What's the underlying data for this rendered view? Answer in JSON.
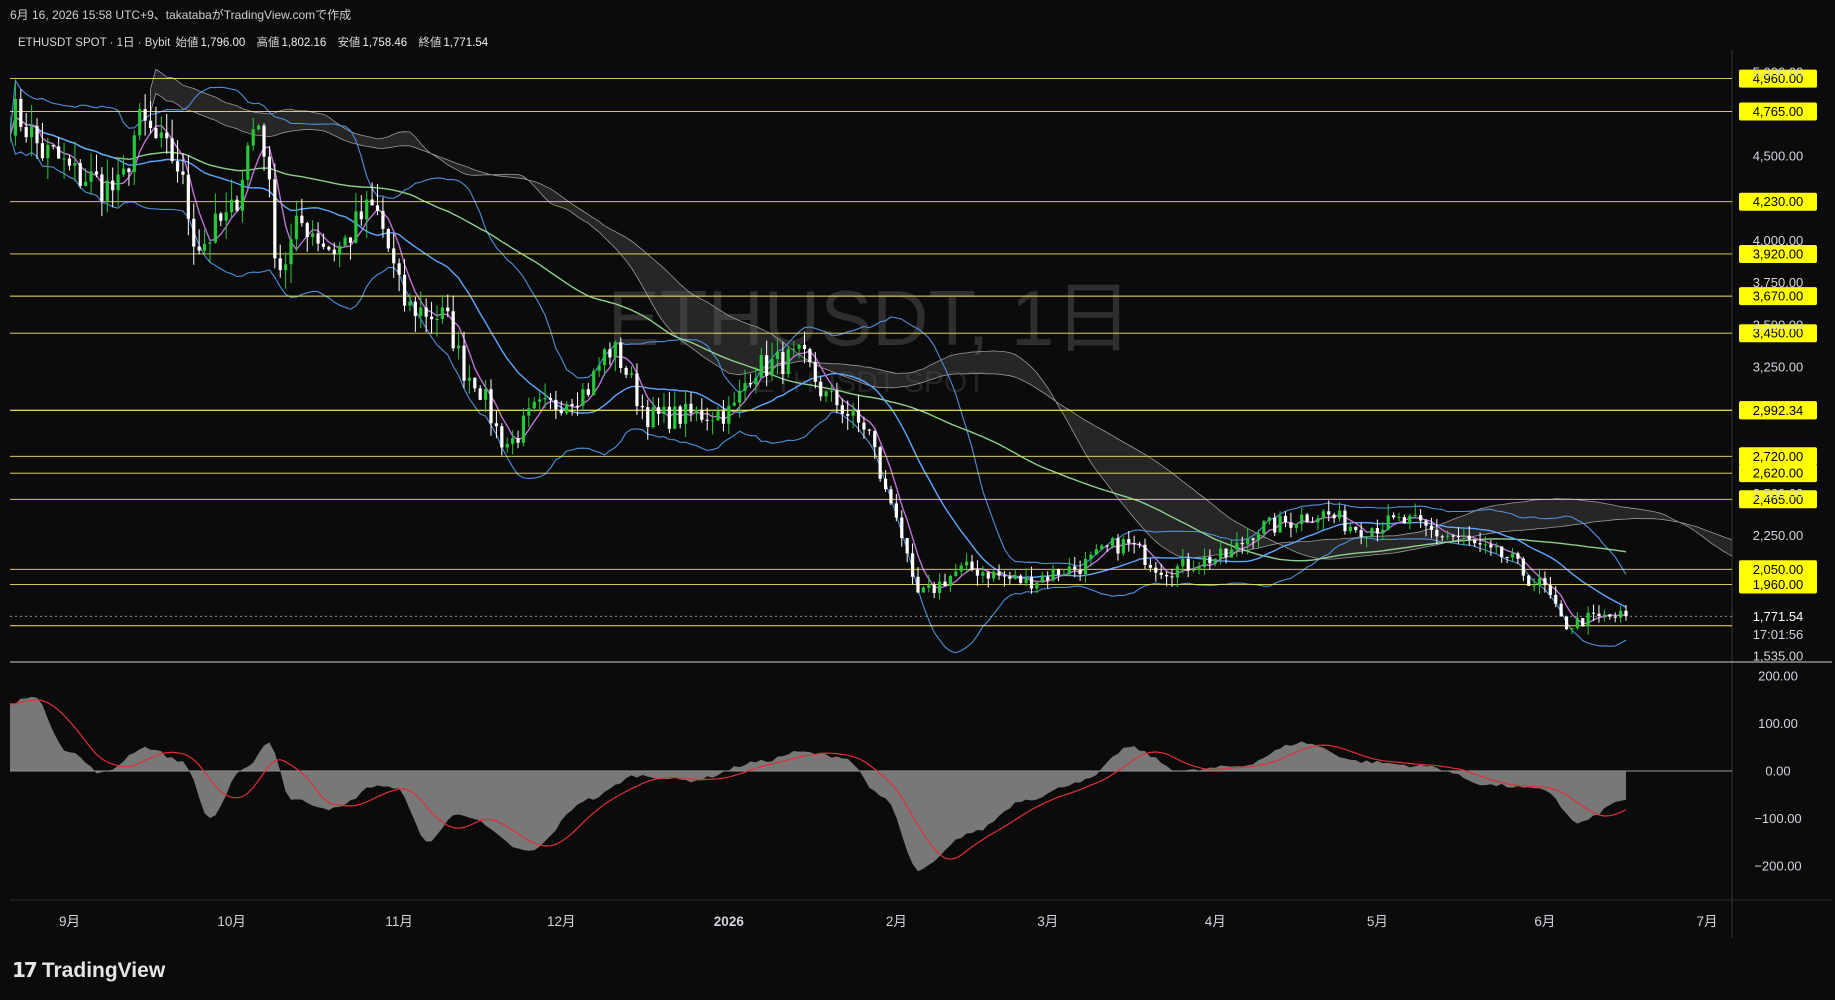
{
  "header": {
    "caption": "6月 16, 2026 15:58 UTC+9、takatabaがTradingView.comで作成",
    "symbol": "ETHUSDT SPOT · 1日 · Bybit",
    "ohlc": [
      {
        "label": "始値",
        "value": "1,796.00"
      },
      {
        "label": "高値",
        "value": "1,802.16"
      },
      {
        "label": "安値",
        "value": "1,758.46"
      },
      {
        "label": "終値",
        "value": "1,771.54"
      }
    ]
  },
  "watermark": {
    "main": "ETHUSDT, 1日",
    "sub": "ETHUSDT SPOT"
  },
  "price_axis": {
    "ticks": [
      "5,000.00",
      "4,500.00",
      "4,000.00",
      "3,750.00",
      "3,500.00",
      "3,250.00",
      "2,500.00",
      "2,250.00",
      "1,535.00"
    ],
    "current_price": "1,771.54",
    "countdown": "17:01:56",
    "horizontal_levels": [
      "4,960.00",
      "4,765.00",
      "4,230.00",
      "3,920.00",
      "3,670.00",
      "3,450.00",
      "2,993.51",
      "2,992.34",
      "2,720.00",
      "2,620.00",
      "2,465.00",
      "2,050.00",
      "1,960.00",
      "1,715.00"
    ]
  },
  "oscillator_axis": {
    "ticks": [
      "200.00",
      "100.00",
      "0.00",
      "−100.00",
      "−200.00"
    ]
  },
  "time_axis": {
    "labels": [
      "9月",
      "10月",
      "11月",
      "12月",
      "2026",
      "2月",
      "3月",
      "4月",
      "5月",
      "6月",
      "7月"
    ]
  },
  "brand": {
    "name": "TradingView"
  },
  "colors": {
    "background": "#0b0b0b",
    "level_line": "#f5e663",
    "level_label_bg": "#ffff00",
    "up_candle": "#26c83a",
    "down_candle": "#ffffff",
    "bollinger": "#4f8fdc",
    "ma_short": "#c070d8",
    "ma_mid": "#5fa6ff",
    "ma_long": "#8ed08e",
    "ichimoku_cloud": "#5a5a5a",
    "oscillator_fill": "#8c8c8c",
    "oscillator_signal": "#e0303a"
  },
  "chart_data": {
    "type": "candlestick",
    "title": "ETHUSDT, 1日",
    "x_range": [
      "2025-08-21",
      "2026-06-16"
    ],
    "price_range": [
      1500,
      5100
    ],
    "candles_anchor_closes": [
      [
        "2025-08-22",
        4740
      ],
      [
        "2025-08-28",
        4510
      ],
      [
        "2025-09-03",
        4380
      ],
      [
        "2025-09-10",
        4300
      ],
      [
        "2025-09-14",
        4680
      ],
      [
        "2025-09-20",
        4500
      ],
      [
        "2025-09-25",
        3980
      ],
      [
        "2025-09-30",
        4120
      ],
      [
        "2025-10-06",
        4700
      ],
      [
        "2025-10-10",
        3850
      ],
      [
        "2025-10-14",
        4100
      ],
      [
        "2025-10-20",
        3950
      ],
      [
        "2025-10-27",
        4180
      ],
      [
        "2025-11-03",
        3600
      ],
      [
        "2025-11-09",
        3550
      ],
      [
        "2025-11-14",
        3200
      ],
      [
        "2025-11-21",
        2800
      ],
      [
        "2025-11-27",
        3000
      ],
      [
        "2025-12-05",
        3100
      ],
      [
        "2025-12-10",
        3350
      ],
      [
        "2025-12-18",
        2950
      ],
      [
        "2026-01-01",
        2980
      ],
      [
        "2026-01-06",
        3250
      ],
      [
        "2026-01-14",
        3300
      ],
      [
        "2026-01-20",
        3050
      ],
      [
        "2026-01-26",
        2900
      ],
      [
        "2026-01-31",
        2450
      ],
      [
        "2026-02-05",
        1900
      ],
      [
        "2026-02-14",
        2050
      ],
      [
        "2026-02-25",
        1980
      ],
      [
        "2026-03-05",
        2050
      ],
      [
        "2026-03-15",
        2200
      ],
      [
        "2026-03-23",
        2050
      ],
      [
        "2026-04-02",
        2120
      ],
      [
        "2026-04-10",
        2300
      ],
      [
        "2026-04-20",
        2380
      ],
      [
        "2026-04-28",
        2300
      ],
      [
        "2026-05-06",
        2330
      ],
      [
        "2026-05-14",
        2250
      ],
      [
        "2026-05-24",
        2130
      ],
      [
        "2026-05-31",
        1960
      ],
      [
        "2026-06-05",
        1720
      ],
      [
        "2026-06-10",
        1760
      ],
      [
        "2026-06-16",
        1771.54
      ]
    ],
    "oscillator_range": [
      -230,
      230
    ],
    "oscillator_anchor": [
      [
        "2025-08-21",
        140
      ],
      [
        "2025-08-25",
        160
      ],
      [
        "2025-09-01",
        40
      ],
      [
        "2025-09-07",
        -5
      ],
      [
        "2025-09-15",
        50
      ],
      [
        "2025-09-22",
        20
      ],
      [
        "2025-09-27",
        -100
      ],
      [
        "2025-10-03",
        0
      ],
      [
        "2025-10-08",
        60
      ],
      [
        "2025-10-12",
        -60
      ],
      [
        "2025-10-20",
        -80
      ],
      [
        "2025-10-28",
        -30
      ],
      [
        "2025-11-01",
        -40
      ],
      [
        "2025-11-06",
        -150
      ],
      [
        "2025-11-12",
        -90
      ],
      [
        "2025-11-25",
        -170
      ],
      [
        "2025-12-06",
        -60
      ],
      [
        "2025-12-15",
        -10
      ],
      [
        "2025-12-25",
        -20
      ],
      [
        "2026-01-07",
        20
      ],
      [
        "2026-01-14",
        40
      ],
      [
        "2026-01-22",
        30
      ],
      [
        "2026-01-30",
        -60
      ],
      [
        "2026-02-05",
        -210
      ],
      [
        "2026-02-15",
        -130
      ],
      [
        "2026-02-25",
        -60
      ],
      [
        "2026-03-08",
        -20
      ],
      [
        "2026-03-16",
        50
      ],
      [
        "2026-03-26",
        0
      ],
      [
        "2026-04-05",
        10
      ],
      [
        "2026-04-17",
        60
      ],
      [
        "2026-04-28",
        20
      ],
      [
        "2026-05-10",
        10
      ],
      [
        "2026-05-22",
        -30
      ],
      [
        "2026-06-01",
        -40
      ],
      [
        "2026-06-07",
        -110
      ],
      [
        "2026-06-16",
        -60
      ]
    ]
  }
}
